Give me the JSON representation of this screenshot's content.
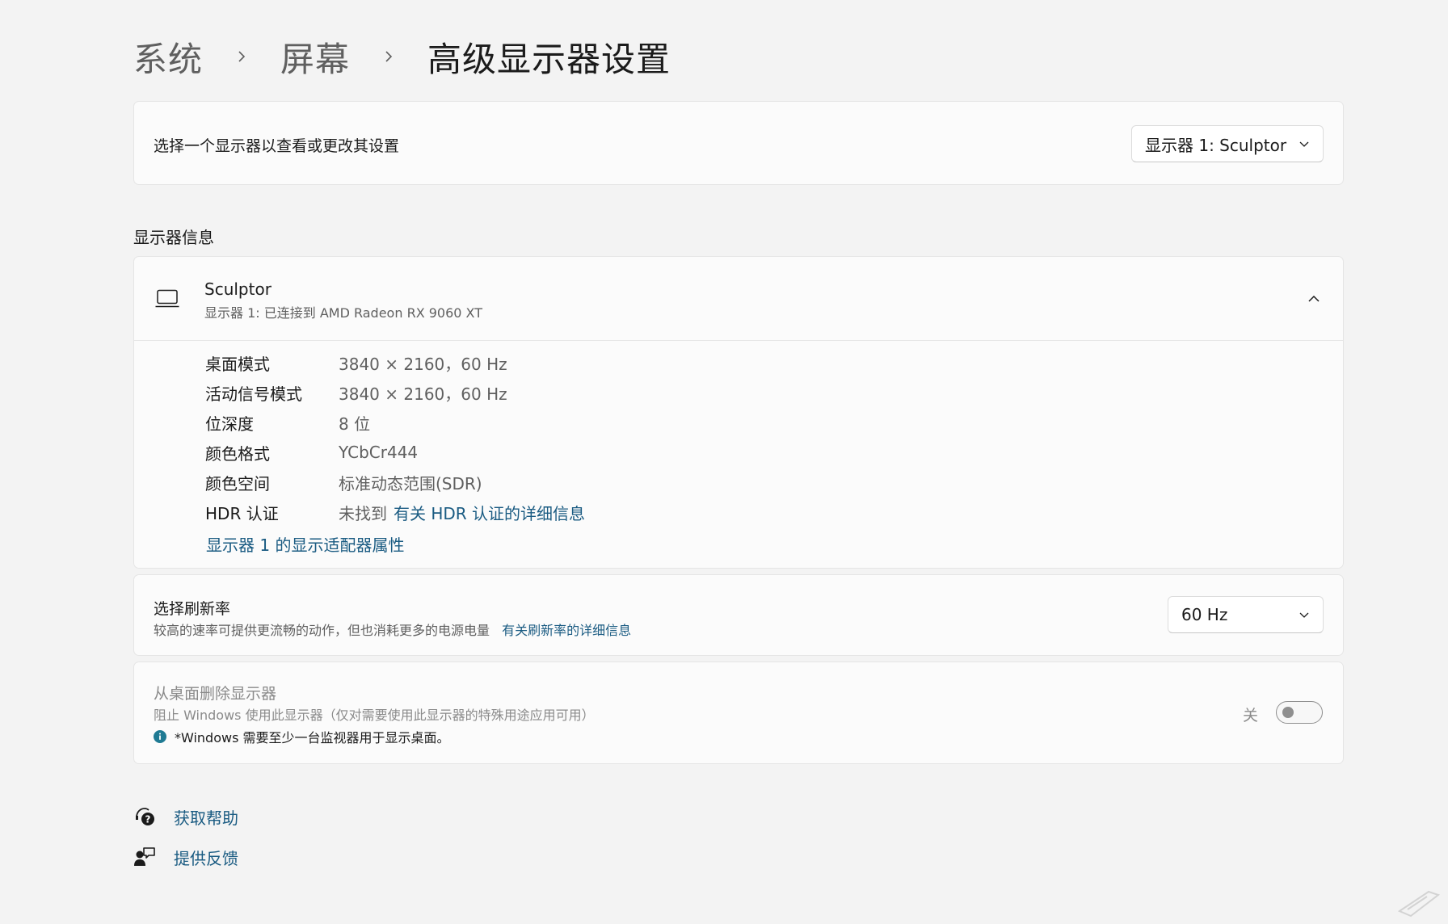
{
  "breadcrumb": {
    "items": [
      "系统",
      "屏幕"
    ],
    "current": "高级显示器设置"
  },
  "display_select": {
    "label": "选择一个显示器以查看或更改其设置",
    "value": "显示器 1: Sculptor"
  },
  "display_info": {
    "section_title": "显示器信息",
    "name": "Sculptor",
    "subtitle": "显示器 1: 已连接到 AMD Radeon RX 9060 XT",
    "rows": [
      {
        "key": "桌面模式",
        "value": "3840 × 2160，60 Hz"
      },
      {
        "key": "活动信号模式",
        "value": "3840 × 2160，60 Hz"
      },
      {
        "key": "位深度",
        "value": "8 位"
      },
      {
        "key": "颜色格式",
        "value": "YCbCr444"
      },
      {
        "key": "颜色空间",
        "value": "标准动态范围(SDR)"
      }
    ],
    "hdr_key": "HDR 认证",
    "hdr_value": "未找到",
    "hdr_link": "有关 HDR 认证的详细信息",
    "adapter_link": "显示器 1 的显示适配器属性"
  },
  "refresh_rate": {
    "label": "选择刷新率",
    "description": "较高的速率可提供更流畅的动作，但也消耗更多的电源电量",
    "link": "有关刷新率的详细信息",
    "value": "60 Hz"
  },
  "remove_display": {
    "label": "从桌面删除显示器",
    "description": "阻止 Windows 使用此显示器（仅对需要使用此显示器的特殊用途应用可用）",
    "note": "*Windows 需要至少一台监视器用于显示桌面。",
    "toggle_label": "关",
    "toggle_state": "off"
  },
  "footer": {
    "help": "获取帮助",
    "feedback": "提供反馈"
  },
  "colors": {
    "accent_link": "#1a5b82",
    "info_badge": "#1f7a93",
    "background": "#f3f3f3"
  },
  "icons": [
    "chevron-right-icon",
    "chevron-down-icon",
    "chevron-up-icon",
    "laptop-icon",
    "info-icon",
    "help-icon",
    "feedback-icon"
  ]
}
